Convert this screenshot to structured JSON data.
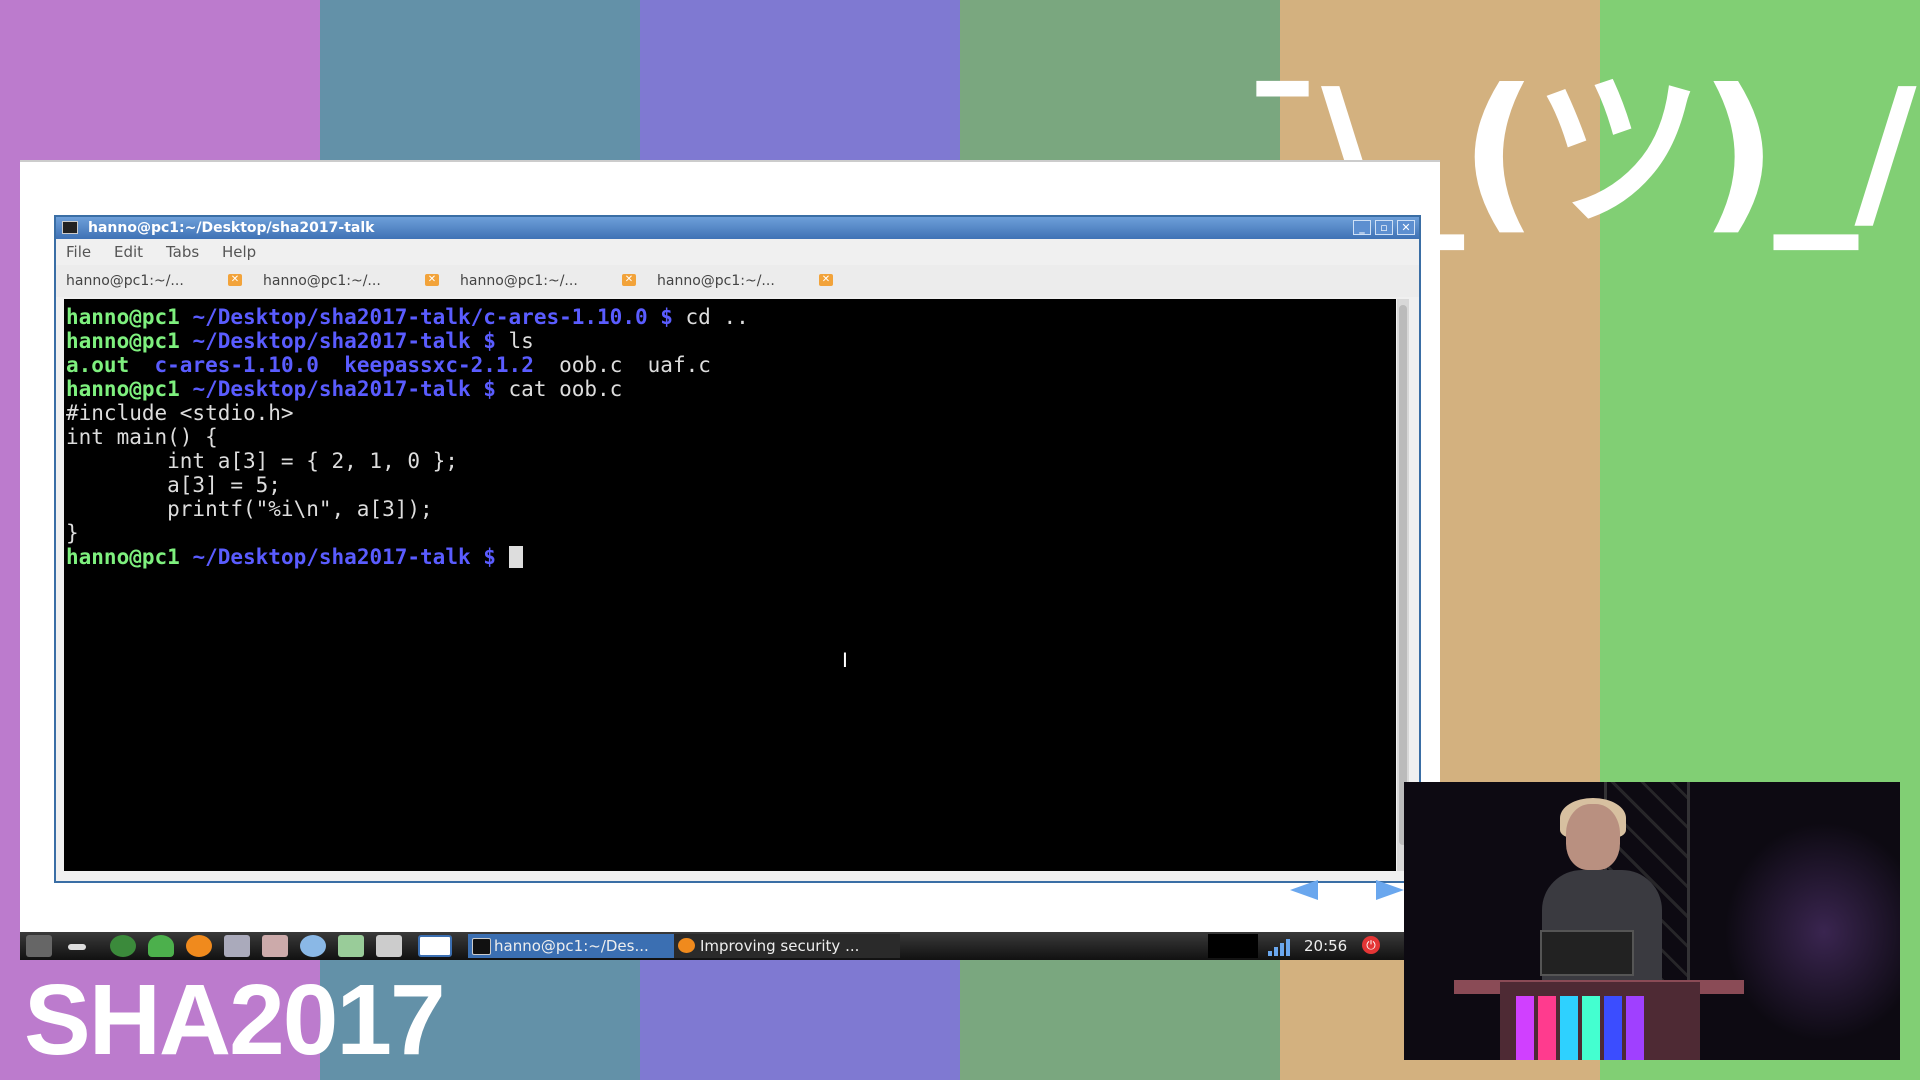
{
  "background": {
    "stripe_colors": [
      "#bc7bcd",
      "#6391a8",
      "#7f79d2",
      "#7aa77f",
      "#d3b17f",
      "#81cf74"
    ],
    "shrug_text": "¯\\_(ツ)_/¯",
    "logo_text": "SHA2017"
  },
  "terminal_window": {
    "title": "hanno@pc1:~/Desktop/sha2017-talk",
    "menu": [
      "File",
      "Edit",
      "Tabs",
      "Help"
    ],
    "tabs": [
      "hanno@pc1:~/...",
      "hanno@pc1:~/...",
      "hanno@pc1:~/...",
      "hanno@pc1:~/..."
    ],
    "user_host": "hanno@pc1",
    "lines": {
      "l1_path": "~/Desktop/sha2017-talk/c-ares-1.10.0 $",
      "l1_cmd": " cd ..",
      "l2_path": "~/Desktop/sha2017-talk $",
      "l2_cmd": " ls",
      "ls_files": [
        "a.out",
        "c-ares-1.10.0",
        "keepassxc-2.1.2",
        "oob.c",
        "uaf.c"
      ],
      "l4_path": "~/Desktop/sha2017-talk $",
      "l4_cmd": " cat oob.c",
      "code": [
        "#include <stdio.h>",
        "int main() {",
        "        int a[3] = { 2, 1, 0 };",
        "        a[3] = 5;",
        "        printf(\"%i\\n\", a[3]);",
        "}"
      ],
      "prompt_path": "~/Desktop/sha2017-talk $"
    }
  },
  "taskbar": {
    "tasks": [
      {
        "label": "hanno@pc1:~/Des...",
        "icon": "terminal-icon"
      },
      {
        "label": "Improving security ...",
        "icon": "firefox-icon"
      }
    ],
    "clock": "20:56"
  },
  "accent_colors": {
    "prompt_user": "#7ef07e",
    "prompt_path": "#5a5cff",
    "titlebar": "#3f72b5"
  }
}
